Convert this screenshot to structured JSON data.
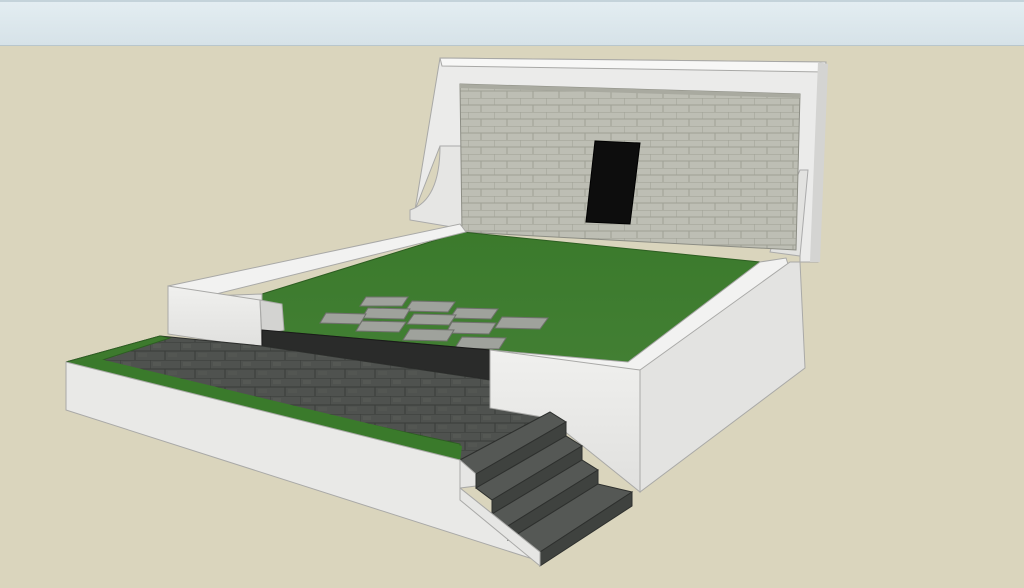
{
  "window": {
    "title": ""
  },
  "scene": {
    "description_hidden": "",
    "colors": {
      "background": "#dad5bd",
      "toolbar": "#dce7ec",
      "wall_white": "#e8e8e6",
      "wall_shadow": "#c9c9c7",
      "grass": "#3f7a2f",
      "grass_dark": "#2f6323",
      "stone_dark": "#4a4d4a",
      "brick": "#b7b8ae",
      "door": "#0d0d0d",
      "paver": "#9a9d97"
    },
    "objects": {
      "back_wall": "back-wall",
      "door": "door-opening",
      "lawn": "upper-lawn",
      "pavers": "stepping-stones",
      "lower_terrace": "lower-terrace",
      "stairs": "stone-stairs"
    }
  }
}
